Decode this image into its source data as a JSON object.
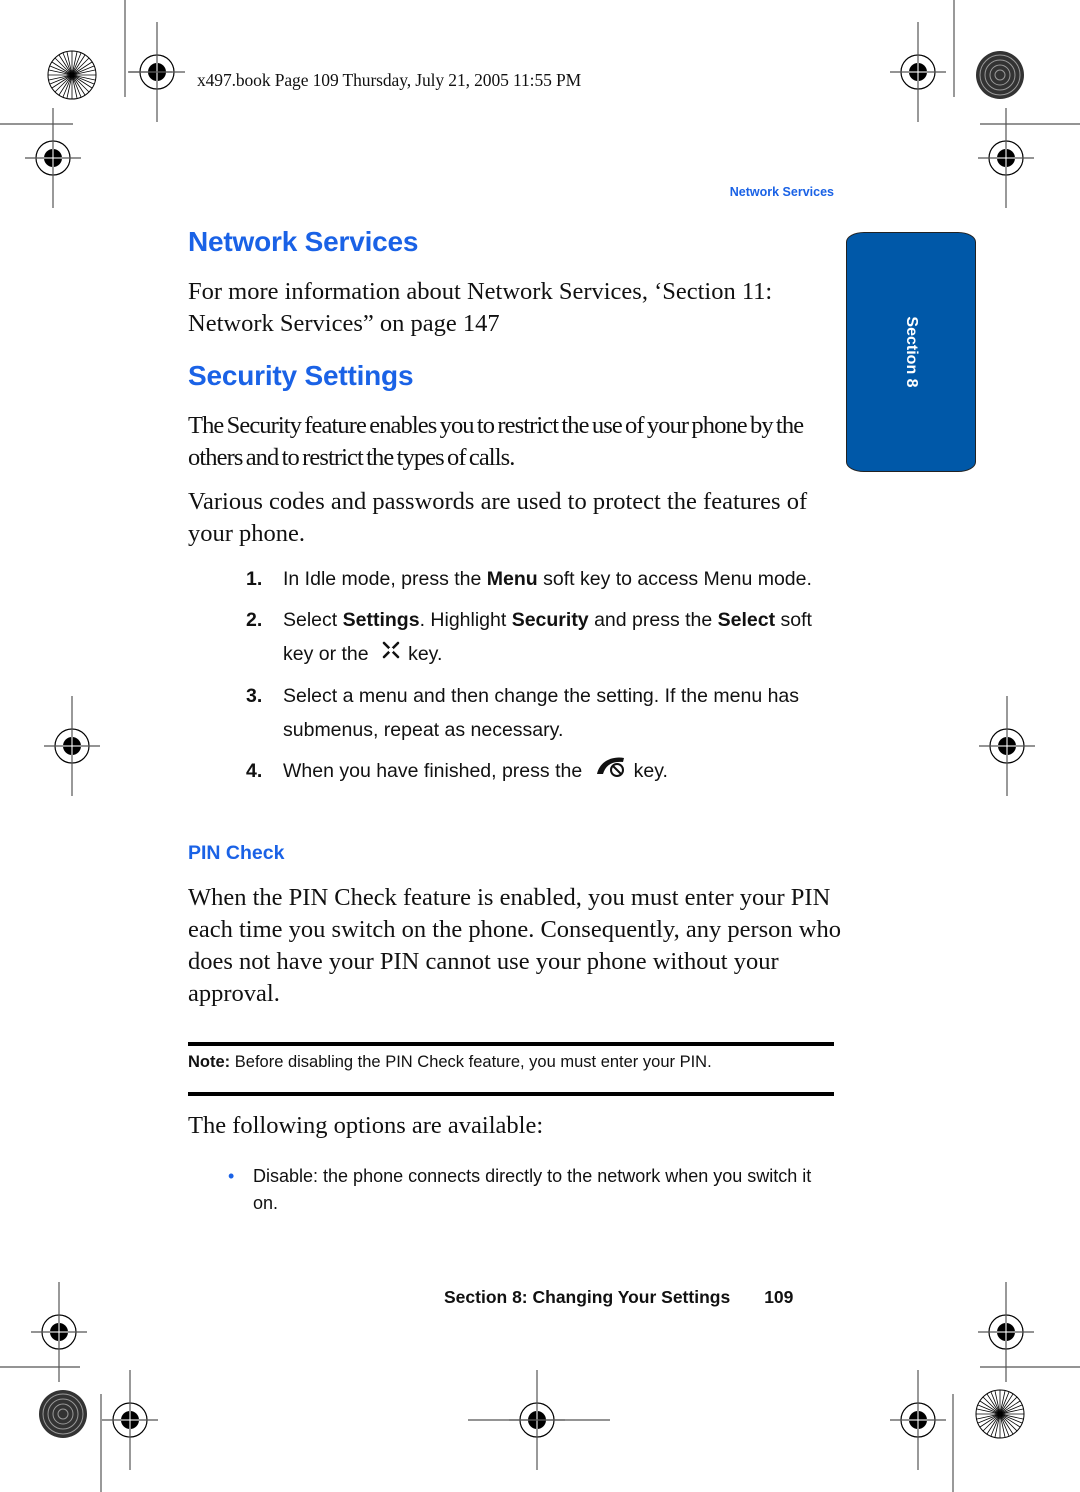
{
  "print_header": "x497.book  Page 109  Thursday, July 21, 2005  11:55 PM",
  "running_header": "Network Services",
  "section_tab": "Section 8",
  "network_services": {
    "heading": "Network Services",
    "body": "For more information about Network Services, ‘Section 11: Network Services” on page 147"
  },
  "security_settings": {
    "heading": "Security Settings",
    "para1": "The Security feature enables you to restrict the use of your phone by the others and to restrict the types of calls.",
    "para2": "Various codes and passwords are used to protect the features of your phone.",
    "steps": [
      {
        "num": "1.",
        "parts": [
          "In Idle mode, press the ",
          "Menu",
          " soft key to access Menu mode."
        ]
      },
      {
        "num": "2.",
        "parts": [
          "Select ",
          "Settings",
          ". Highlight ",
          "Security",
          " and press the ",
          "Select",
          " soft key or the",
          "key."
        ],
        "icon": "navigation-key-icon"
      },
      {
        "num": "3.",
        "text": "Select a menu and then change the setting. If the menu has submenus, repeat as necessary."
      },
      {
        "num": "4.",
        "parts": [
          "When you have finished, press the",
          "key."
        ],
        "icon": "end-key-icon"
      }
    ]
  },
  "pin_check": {
    "heading": "PIN Check",
    "body": "When the PIN Check feature is enabled, you must enter your PIN each time you switch on the phone. Consequently, any person who does not have your PIN cannot use your phone without your approval.",
    "note_label": "Note:",
    "note_text": " Before disabling the PIN Check feature, you must enter your PIN.",
    "options_intro": "The following options are available:",
    "options": [
      {
        "bullet": "•",
        "text": "Disable: the phone connects directly to the network when you switch it on."
      }
    ]
  },
  "footer": {
    "section": "Section 8: Changing Your Settings",
    "page": "109"
  },
  "colors": {
    "accent_blue": "#1a62e6",
    "tab_blue": "#0058a8"
  }
}
